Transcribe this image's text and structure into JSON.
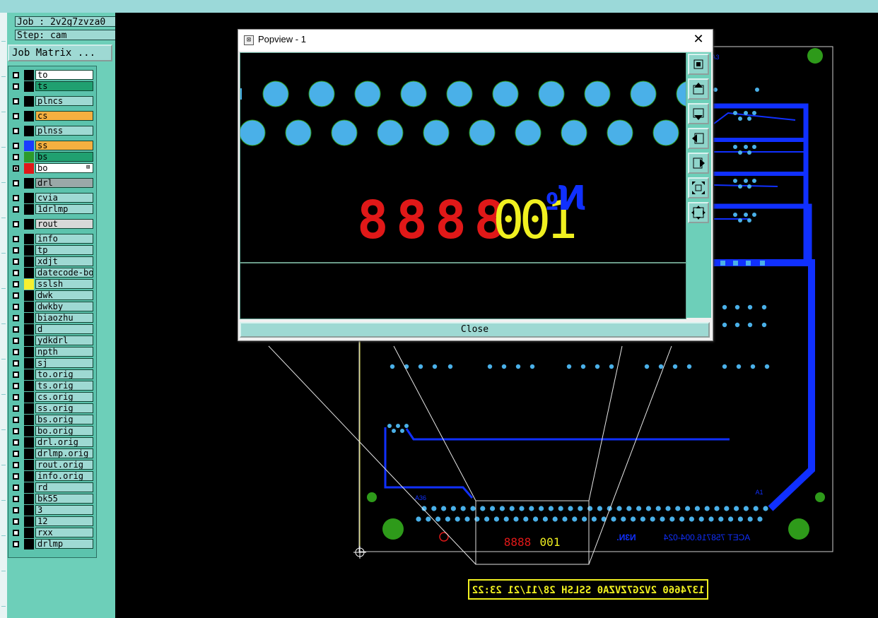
{
  "job_label": "Job : 2v2g7zvza0",
  "step_label": "Step: cam",
  "job_matrix_button": "Job Matrix ...",
  "layers": [
    {
      "name": "to",
      "color": "#ffffff",
      "check_on": false,
      "swatch": "#000000"
    },
    {
      "name": "ts",
      "color": "#20a070",
      "check_on": false,
      "swatch": "#000000"
    },
    {
      "name": "plncs",
      "color": "#9ed9d3",
      "check_on": false,
      "swatch": "#000000"
    },
    {
      "name": "cs",
      "color": "#f5b040",
      "check_on": false,
      "swatch": "#000000"
    },
    {
      "name": "plnss",
      "color": "#9ed9d3",
      "check_on": false,
      "swatch": "#000000"
    },
    {
      "name": "ss",
      "color": "#f5b040",
      "check_on": false,
      "swatch": "#1a3cff"
    },
    {
      "name": "bs",
      "color": "#20a070",
      "check_on": false,
      "swatch": "#2c9a2c"
    },
    {
      "name": "bo",
      "color": "#ffffff",
      "check_on": true,
      "swatch": "#e01818",
      "marker": "⊞"
    },
    {
      "name": "drl",
      "color": "#9aa8a8",
      "check_on": false,
      "swatch": "#000000"
    },
    {
      "name": "cvia",
      "color": "#9ed9d3",
      "check_on": false,
      "swatch": "#000000"
    },
    {
      "name": "1drlmp",
      "color": "#9ed9d3",
      "check_on": false,
      "swatch": "#000000"
    },
    {
      "name": "rout",
      "color": "#d8d8d8",
      "check_on": false,
      "swatch": "#000000"
    },
    {
      "name": "info",
      "color": "#9ed9d3",
      "check_on": false,
      "swatch": "#000000"
    },
    {
      "name": "tp",
      "color": "#9ed9d3",
      "check_on": false,
      "swatch": "#000000"
    },
    {
      "name": "xdjt",
      "color": "#9ed9d3",
      "check_on": false,
      "swatch": "#000000"
    },
    {
      "name": "datecode-bo",
      "color": "#9ed9d3",
      "check_on": false,
      "swatch": "#000000"
    },
    {
      "name": "sslsh",
      "color": "#9ed9d3",
      "check_on": false,
      "swatch": "#f5f030"
    },
    {
      "name": "dwk",
      "color": "#9ed9d3",
      "check_on": false,
      "swatch": "#000000"
    },
    {
      "name": "dwkby",
      "color": "#9ed9d3",
      "check_on": false,
      "swatch": "#000000"
    },
    {
      "name": "biaozhu",
      "color": "#9ed9d3",
      "check_on": false,
      "swatch": "#000000"
    },
    {
      "name": "d",
      "color": "#9ed9d3",
      "check_on": false,
      "swatch": "#000000"
    },
    {
      "name": "ydkdrl",
      "color": "#9ed9d3",
      "check_on": false,
      "swatch": "#000000"
    },
    {
      "name": "npth",
      "color": "#9ed9d3",
      "check_on": false,
      "swatch": "#000000"
    },
    {
      "name": "sj",
      "color": "#9ed9d3",
      "check_on": false,
      "swatch": "#000000"
    },
    {
      "name": "to.orig",
      "color": "#9ed9d3",
      "check_on": false,
      "swatch": "#000000"
    },
    {
      "name": "ts.orig",
      "color": "#9ed9d3",
      "check_on": false,
      "swatch": "#000000"
    },
    {
      "name": "cs.orig",
      "color": "#9ed9d3",
      "check_on": false,
      "swatch": "#000000"
    },
    {
      "name": "ss.orig",
      "color": "#9ed9d3",
      "check_on": false,
      "swatch": "#000000"
    },
    {
      "name": "bs.orig",
      "color": "#9ed9d3",
      "check_on": false,
      "swatch": "#000000"
    },
    {
      "name": "bo.orig",
      "color": "#9ed9d3",
      "check_on": false,
      "swatch": "#000000"
    },
    {
      "name": "drl.orig",
      "color": "#9ed9d3",
      "check_on": false,
      "swatch": "#000000"
    },
    {
      "name": "drlmp.orig",
      "color": "#9ed9d3",
      "check_on": false,
      "swatch": "#000000"
    },
    {
      "name": "rout.orig",
      "color": "#9ed9d3",
      "check_on": false,
      "swatch": "#000000"
    },
    {
      "name": "info.orig",
      "color": "#9ed9d3",
      "check_on": false,
      "swatch": "#000000"
    },
    {
      "name": "rd",
      "color": "#9ed9d3",
      "check_on": false,
      "swatch": "#000000"
    },
    {
      "name": "bk55",
      "color": "#9ed9d3",
      "check_on": false,
      "swatch": "#000000"
    },
    {
      "name": "3",
      "color": "#9ed9d3",
      "check_on": false,
      "swatch": "#000000"
    },
    {
      "name": "12",
      "color": "#9ed9d3",
      "check_on": false,
      "swatch": "#000000"
    },
    {
      "name": "rxx",
      "color": "#9ed9d3",
      "check_on": false,
      "swatch": "#000000"
    },
    {
      "name": "drlmp",
      "color": "#9ed9d3",
      "check_on": false,
      "swatch": "#000000"
    }
  ],
  "popup": {
    "title": "Popview - 1",
    "close_glyph": "✕",
    "close_button": "Close",
    "preview_number": "001",
    "preview_digits": "8888",
    "preview_mark": "№",
    "tools": [
      "zoom-fit-icon",
      "pan-up-icon",
      "pan-down-icon",
      "pan-left-icon",
      "pan-right-icon",
      "zoom-in-icon",
      "zoom-out-icon"
    ]
  },
  "board": {
    "mirrored_text": "ACET 758716.004-024",
    "n_label": "N3N.",
    "a1_label": "A1",
    "a36_label": "A36",
    "a3_label": "A3",
    "small_digits": "8888",
    "small_number": "001",
    "bottom_label": "1374660   2V2G7ZVZA0 SSLSH 28/11/21 23:22"
  },
  "colors": {
    "copper": "#1030ff",
    "pad": "#4ab0e8",
    "green": "#2e9a1a",
    "red_text": "#e01818",
    "yellow_text": "#f0f020",
    "outline": "#d0d0d0"
  }
}
